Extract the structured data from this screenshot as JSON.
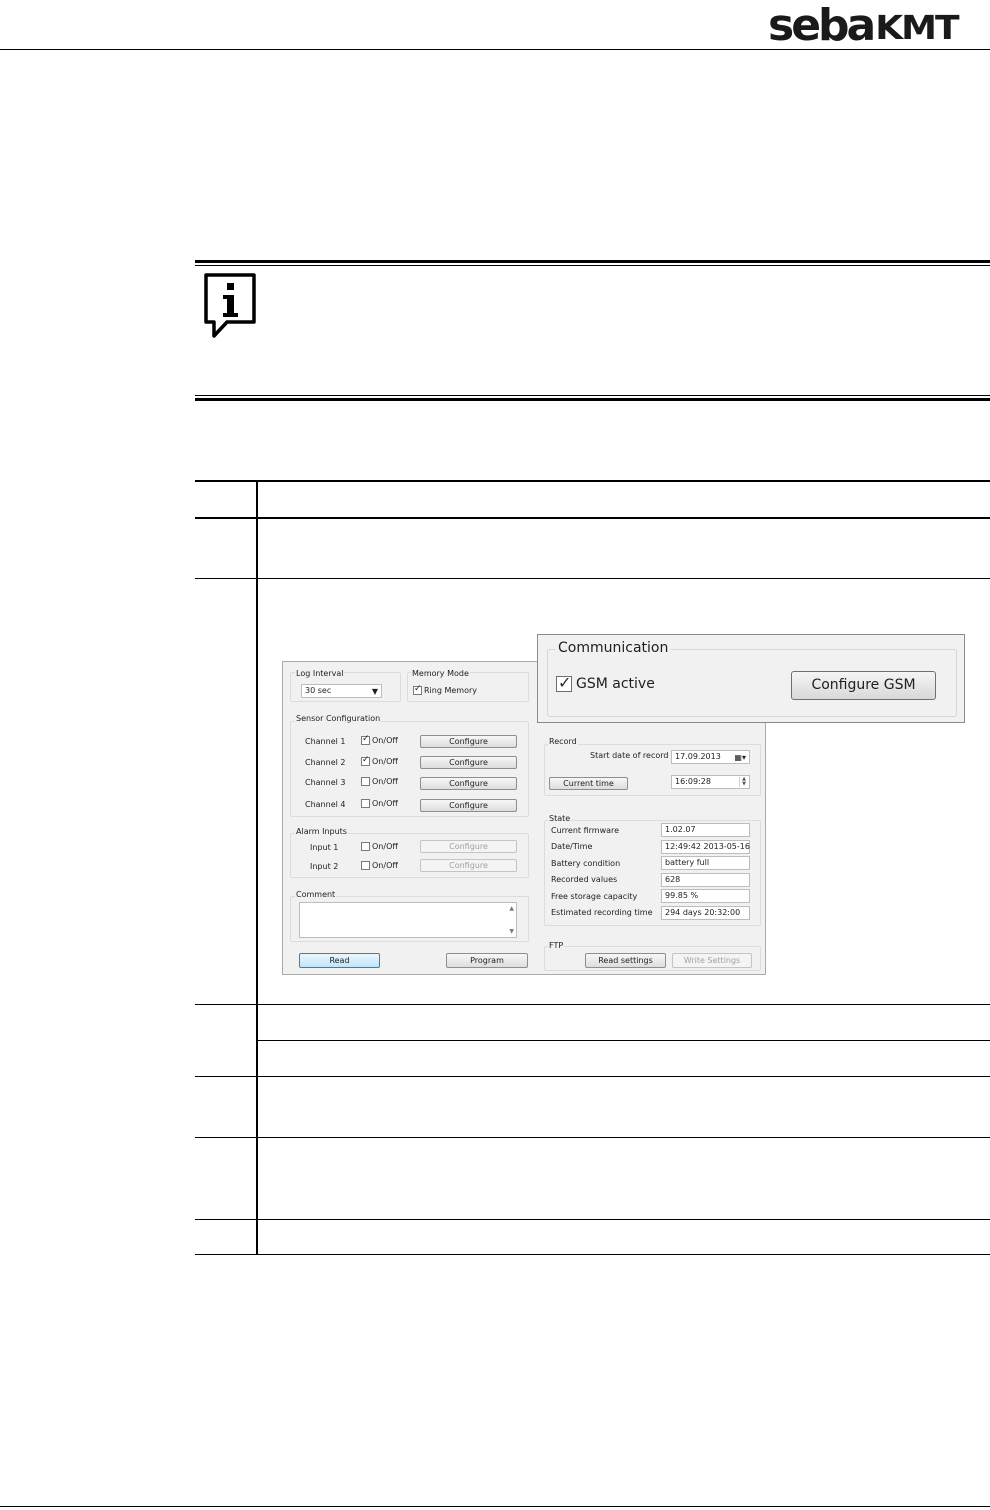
{
  "header": {
    "logo_left": "seba",
    "logo_right": "KMT"
  },
  "dialog": {
    "log_interval": {
      "label": "Log Interval",
      "value": "30 sec"
    },
    "memory_mode": {
      "label": "Memory Mode",
      "ring_memory_label": "Ring Memory",
      "ring_memory_checked": true
    },
    "sensor_configuration": {
      "label": "Sensor Configuration",
      "channels": [
        {
          "name": "Channel 1",
          "toggle": "On/Off",
          "checked": true,
          "button": "Configure"
        },
        {
          "name": "Channel 2",
          "toggle": "On/Off",
          "checked": true,
          "button": "Configure"
        },
        {
          "name": "Channel 3",
          "toggle": "On/Off",
          "checked": false,
          "button": "Configure"
        },
        {
          "name": "Channel 4",
          "toggle": "On/Off",
          "checked": false,
          "button": "Configure"
        }
      ]
    },
    "alarm_inputs": {
      "label": "Alarm Inputs",
      "inputs": [
        {
          "name": "Input 1",
          "toggle": "On/Off",
          "checked": false,
          "button": "Configure"
        },
        {
          "name": "Input 2",
          "toggle": "On/Off",
          "checked": false,
          "button": "Configure"
        }
      ]
    },
    "comment": {
      "label": "Comment",
      "value": ""
    },
    "buttons": {
      "read": "Read",
      "program": "Program"
    },
    "record": {
      "label": "Record",
      "start_date_label": "Start date of record",
      "start_date": "17.09.2013",
      "current_time_button": "Current time",
      "time": "16:09:28"
    },
    "state": {
      "label": "State",
      "rows": [
        {
          "label": "Current firmware",
          "value": "1.02.07"
        },
        {
          "label": "Date/Time",
          "value": "12:49:42 2013-05-16"
        },
        {
          "label": "Battery condition",
          "value": "battery full"
        },
        {
          "label": "Recorded values",
          "value": "628"
        },
        {
          "label": "Free storage capacity",
          "value": "99.85 %"
        },
        {
          "label": "Estimated recording time",
          "value": "294 days 20:32:00"
        }
      ]
    },
    "ftp": {
      "label": "FTP",
      "read_settings": "Read settings",
      "write_settings": "Write Settings"
    }
  },
  "communication": {
    "label": "Communication",
    "gsm_active_label": "GSM active",
    "gsm_active_checked": true,
    "configure_button": "Configure GSM"
  }
}
